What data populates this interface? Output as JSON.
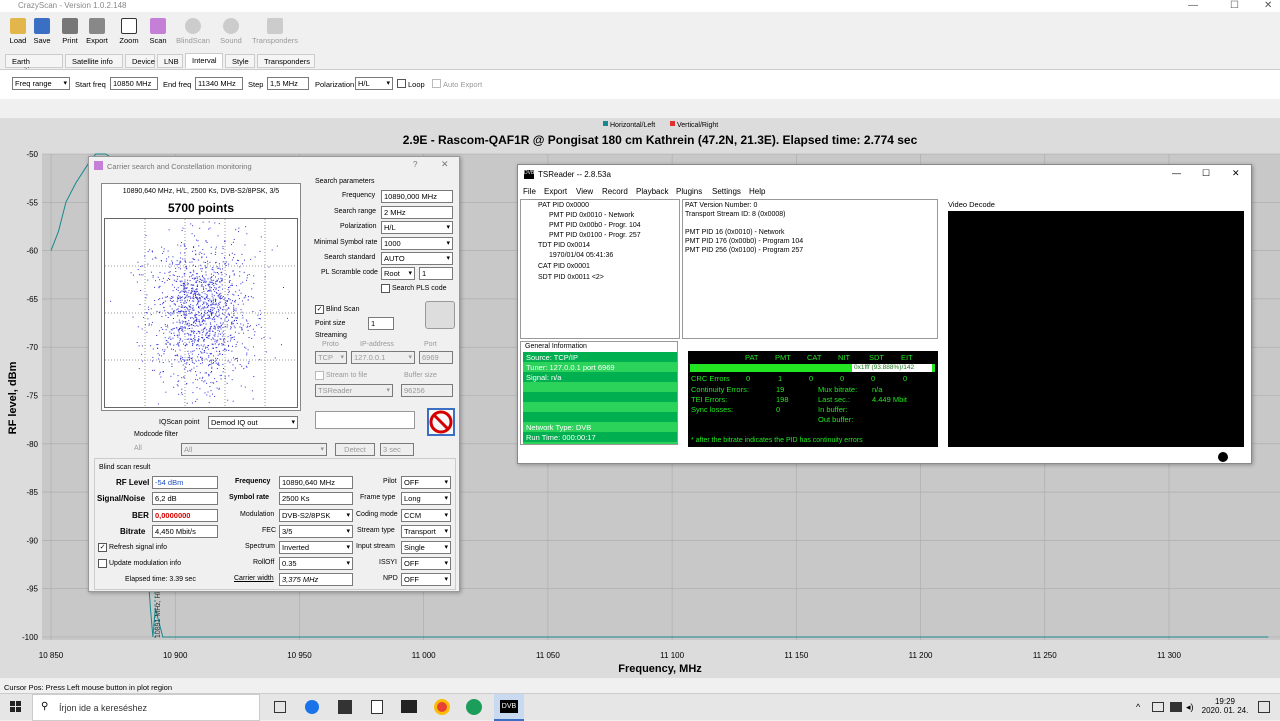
{
  "app": {
    "title": "CrazyScan - Version 1.0.2.148"
  },
  "toolbar": {
    "items": [
      "Load",
      "Save",
      "Print",
      "Export",
      "Zoom",
      "Scan",
      "BlindScan",
      "Sound",
      "Transponders"
    ]
  },
  "tabs": [
    "Earth position",
    "Satellite info",
    "Device",
    "LNB",
    "Interval",
    "Style",
    "Transponders"
  ],
  "controls": {
    "mode": "Freq range",
    "start_label": "Start freq",
    "start": "10850 MHz",
    "end_label": "End freq",
    "end": "11340 MHz",
    "step_label": "Step",
    "step": "1,5 MHz",
    "pol_label": "Polarization",
    "pol": "H/L",
    "loop": "Loop",
    "autoexport": "Auto Export"
  },
  "legend": {
    "h": "Horizontal/Left",
    "v": "Vertical/Right"
  },
  "plot": {
    "title": "2.9E - Rascom-QAF1R  @ Pongisat  180 cm Kathrein (47.2N, 21.3E). Elapsed time: 2.774 sec",
    "ylabel": "RF level, dBm",
    "xlabel": "Frequency, MHz",
    "yticks": [
      "-50",
      "-55",
      "-60",
      "-65",
      "-70",
      "-75",
      "-80",
      "-85",
      "-90",
      "-95",
      "-100"
    ],
    "xticks": [
      "10 850",
      "10 900",
      "10 950",
      "11 000",
      "11 050",
      "11 100",
      "11 150",
      "11 200",
      "11 250",
      "11 300"
    ],
    "marker": "10891 MHz, H/L"
  },
  "chart_data": {
    "type": "line",
    "xlabel": "Frequency, MHz",
    "ylabel": "RF level, dBm",
    "xlim": [
      10850,
      11340
    ],
    "ylim": [
      -100,
      -50
    ],
    "series": [
      {
        "name": "Horizontal/Left",
        "x": [
          10850,
          10853,
          10856,
          10860,
          10865,
          10868,
          10870,
          10872,
          10878,
          10880,
          10890,
          10891,
          10892,
          10895,
          10900,
          11000,
          11100,
          11200,
          11300,
          11340
        ],
        "y": [
          -60,
          -58,
          -55,
          -53,
          -51,
          -50,
          -50,
          -50,
          -51,
          -60,
          -97,
          -100,
          -97,
          -100,
          -100,
          -100,
          -100,
          -100,
          -100,
          -100
        ]
      }
    ]
  },
  "dialog": {
    "title": "Carrier search and Constellation monitoring",
    "info": "10890,640 MHz, H/L, 2500 Ks, DVB-S2/8PSK, 3/5",
    "points": "5700 points",
    "iq_label": "IQScan point",
    "iq": "Demod IQ out",
    "modcode_filter": "Modcode filter",
    "modcode_label": "Modcode",
    "modcode": "All",
    "detect": "Detect",
    "sec": "3 sec",
    "sp_title": "Search parameters",
    "sp": [
      {
        "l": "Frequency",
        "v": "10890,000 MHz"
      },
      {
        "l": "Search range",
        "v": "2 MHz"
      },
      {
        "l": "Polarization",
        "v": "H/L"
      },
      {
        "l": "Minimal Symbol rate",
        "v": "1000"
      },
      {
        "l": "Search standard",
        "v": "AUTO"
      },
      {
        "l": "PL Scramble code",
        "v": "Root"
      }
    ],
    "pls_num": "1",
    "search_pls": "Search PLS code",
    "blind": "Blind Scan",
    "point_size": "Point size",
    "ps_val": "1",
    "streaming": "Streaming",
    "proto": "Proto",
    "ip": "IP-address",
    "port": "Port",
    "proto_v": "TCP",
    "ip_v": "127.0.0.1",
    "port_v": "6969",
    "stream_file": "Stream to file",
    "buffer": "Buffer size",
    "tsreader": "TSReader",
    "buf_v": "96256",
    "result_title": "Blind scan result",
    "rf_l": "RF Level",
    "rf": "-54 dBm",
    "sn_l": "Signal/Noise",
    "sn": "6,2 dB",
    "ber_l": "BER",
    "ber": "0,0000000",
    "br_l": "Bitrate",
    "br": "4,450 Mbit/s",
    "fr_l": "Frequency",
    "fr": "10890,640 MHz",
    "sr_l": "Symbol rate",
    "sr": "2500 Ks",
    "mod_l": "Modulation",
    "mod": "DVB-S2/8PSK",
    "fec_l": "FEC",
    "fec": "3/5",
    "spec_l": "Spectrum",
    "spec": "Inverted",
    "ro_l": "RollOff",
    "ro": "0.35",
    "cw_l": "Carrier width",
    "cw": "3,375 MHz",
    "pilot_l": "Pilot",
    "pilot": "OFF",
    "ft_l": "Frame type",
    "ft": "Long",
    "cm_l": "Coding mode",
    "cm": "CCM",
    "st_l": "Stream type",
    "st": "Transport",
    "is_l": "Input stream",
    "is": "Single",
    "issyi_l": "ISSYI",
    "issyi": "OFF",
    "npd_l": "NPD",
    "npd": "OFF",
    "refresh": "Refresh signal info",
    "update": "Update modulation info",
    "elapsed": "Elapsed time: 3.39 sec"
  },
  "tsreader": {
    "title": "TSReader -- 2.8.53a",
    "menu": [
      "File",
      "Export",
      "View",
      "Record",
      "Playback",
      "Plugins",
      "Settings",
      "Help"
    ],
    "tree": [
      "PAT PID 0x0000",
      "PMT PID 0x0010 - Network",
      "PMT PID 0x00b0 - Progr. 104",
      "PMT PID 0x0100 - Progr. 257",
      "TDT PID 0x0014",
      "1970/01/04 05:41:36",
      "CAT PID 0x0001",
      "SDT PID 0x0011 <2>"
    ],
    "info": [
      "PAT Version Number: 0",
      "Transport Stream ID: 8 (0x0008)",
      "",
      "PMT PID 16 (0x0010) - Network",
      "PMT PID 176 (0x00b0) - Program 104",
      "PMT PID 256 (0x0100) - Program 257"
    ],
    "video": "Video Decode",
    "gi": "General Information",
    "gi_lines": [
      "Source: TCP/IP",
      "Tuner: 127.0.0.1 port 6969",
      "Signal: n/a",
      "",
      "",
      "",
      "Network Type: DVB",
      "Run Time: 000:00:17"
    ],
    "hdr": [
      "PAT",
      "PMT",
      "CAT",
      "NIT",
      "SDT",
      "EIT"
    ],
    "bar": "0x1fff (93.888%)/142",
    "crc": "CRC Errors",
    "crc_v": [
      "0",
      "1",
      "0",
      "0",
      "0",
      "0"
    ],
    "cont": "Continuity Errors:",
    "cont_v": "19",
    "tei": "TEI Errors:",
    "tei_v": "198",
    "sync": "Sync losses:",
    "sync_v": "0",
    "mux": "Mux bitrate:",
    "mux_v": "n/a",
    "last": "Last sec.:",
    "last_v": "4.449 Mbit",
    "inbuf": "In buffer:",
    "outbuf": "Out buffer:",
    "note": "* after the bitrate indicates the PID has continuity errors"
  },
  "statusbar": "Cursor Pos: Press Left mouse button in plot region",
  "taskbar": {
    "search": "Írjon ide a kereséshez",
    "time": "19:29",
    "date": "2020. 01. 24."
  }
}
